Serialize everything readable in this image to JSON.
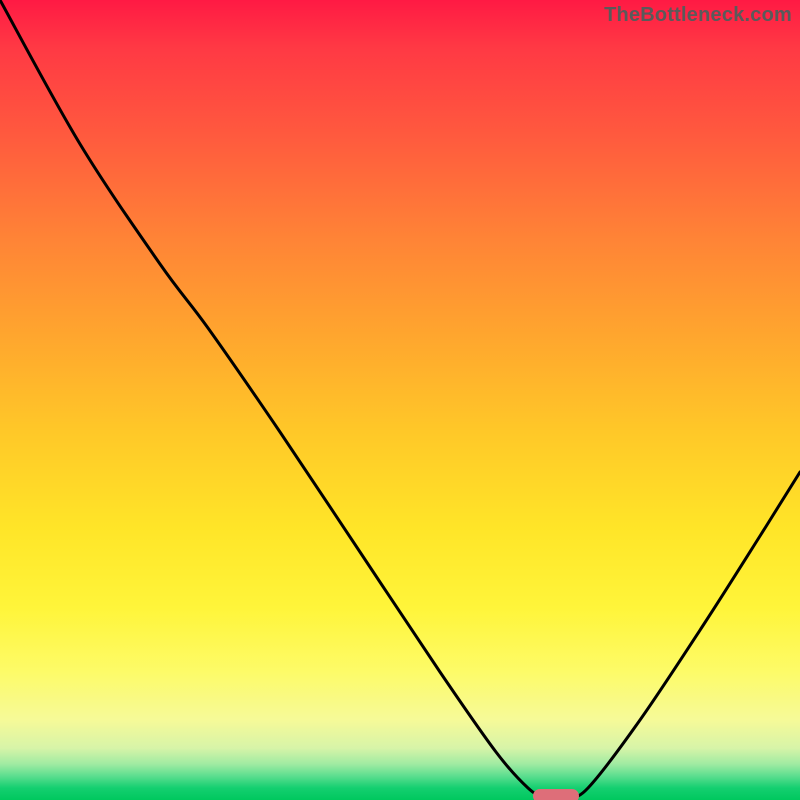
{
  "watermark": "TheBottleneck.com",
  "chart_data": {
    "type": "line",
    "title": "",
    "xlabel": "",
    "ylabel": "",
    "xlim": [
      0,
      100
    ],
    "ylim": [
      0,
      100
    ],
    "grid": false,
    "curve_points": [
      {
        "x": 0.0,
        "y": 100.0
      },
      {
        "x": 10.0,
        "y": 82.0
      },
      {
        "x": 20.0,
        "y": 67.0
      },
      {
        "x": 26.0,
        "y": 59.0
      },
      {
        "x": 35.0,
        "y": 46.0
      },
      {
        "x": 45.0,
        "y": 31.0
      },
      {
        "x": 55.0,
        "y": 16.0
      },
      {
        "x": 62.0,
        "y": 6.0
      },
      {
        "x": 66.0,
        "y": 1.5
      },
      {
        "x": 68.0,
        "y": 0.5
      },
      {
        "x": 71.0,
        "y": 0.5
      },
      {
        "x": 73.5,
        "y": 1.5
      },
      {
        "x": 80.0,
        "y": 10.0
      },
      {
        "x": 88.0,
        "y": 22.0
      },
      {
        "x": 95.0,
        "y": 33.0
      },
      {
        "x": 100.0,
        "y": 41.0
      }
    ],
    "minimum_marker": {
      "x": 69.5,
      "y": 0.5
    },
    "gradient_stops": [
      {
        "pos": 0,
        "color": "#ff1a44"
      },
      {
        "pos": 50,
        "color": "#ffc828"
      },
      {
        "pos": 85,
        "color": "#fdfb68"
      },
      {
        "pos": 100,
        "color": "#00c85e"
      }
    ]
  }
}
